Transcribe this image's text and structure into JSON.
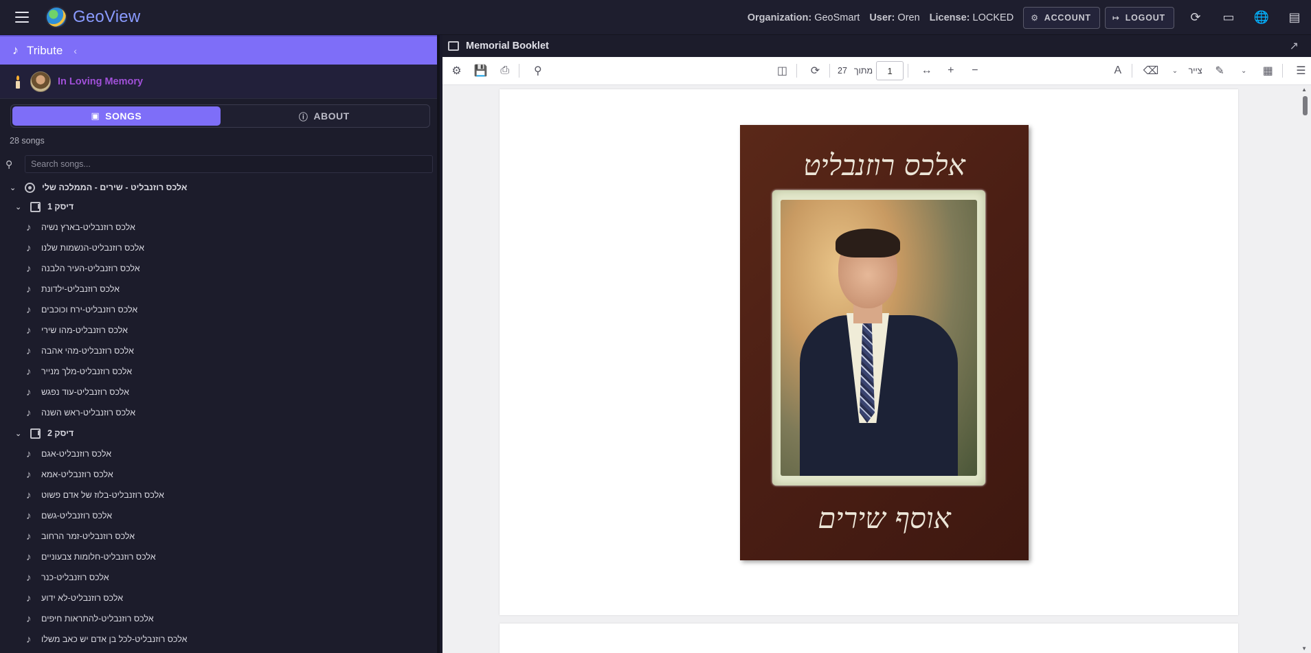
{
  "topbar": {
    "app_title": "GeoView",
    "org_label": "Organization:",
    "org_value": "GeoSmart",
    "user_label": "User:",
    "user_value": "Oren",
    "license_label": "License:",
    "license_value": "LOCKED",
    "account_label": "ACCOUNT",
    "logout_label": "LOGOUT"
  },
  "sidebar": {
    "header_title": "Tribute",
    "memory_text": "In Loving Memory",
    "tabs": [
      {
        "label": "SONGS",
        "active": true
      },
      {
        "label": "ABOUT",
        "active": false
      }
    ],
    "song_count": "28 songs",
    "search_placeholder": "Search songs...",
    "album_title": "אלכס רוזנבליט - שירים - הממלכה שלי",
    "discs": [
      {
        "label": "דיסק 1",
        "songs": [
          "אלכס רוזנבליט-בארץ נשיה",
          "אלכס רוזנבליט-הנשמות שלנו",
          "אלכס רוזנבליט-העיר הלבנה",
          "אלכס רוזנבליט-ילדונת",
          "אלכס רוזנבליט-ירח וכוכבים",
          "אלכס רוזנבליט-מהו שירי",
          "אלכס רוזנבליט-מהי אהבה",
          "אלכס רוזנבליט-מלך מנייר",
          "אלכס רוזנבליט-עוד נפגש",
          "אלכס רוזנבליט-ראש השנה"
        ]
      },
      {
        "label": "דיסק 2",
        "songs": [
          "אלכס רוזנבליט-אגם",
          "אלכס רוזנבליט-אמא",
          "אלכס רוזנבליט-בלוז של אדם פשוט",
          "אלכס רוזנבליט-גשם",
          "אלכס רוזנבליט-זמר הרחוב",
          "אלכס רוזנבליט-חלומות צבעוניים",
          "אלכס רוזנבליט-כנר",
          "אלכס רוזנבליט-לא ידוע",
          "אלכס רוזנבליט-להתראות חיפים",
          "אלכס רוזנבליט-לכל בן אדם יש כאב משלו"
        ]
      }
    ]
  },
  "viewer": {
    "title": "Memorial Booklet",
    "page_total": "27",
    "page_of_label": "מתוך",
    "page_current": "1",
    "draw_label": "צייר",
    "cover_title_top": "אלכס רוזנבליט",
    "cover_title_bottom": "אוסף שירים"
  },
  "colors": {
    "accent": "#7e6ef8",
    "brand_title": "#8a9bff",
    "memory_text": "#a050d8",
    "background": "#1c1c2b"
  }
}
